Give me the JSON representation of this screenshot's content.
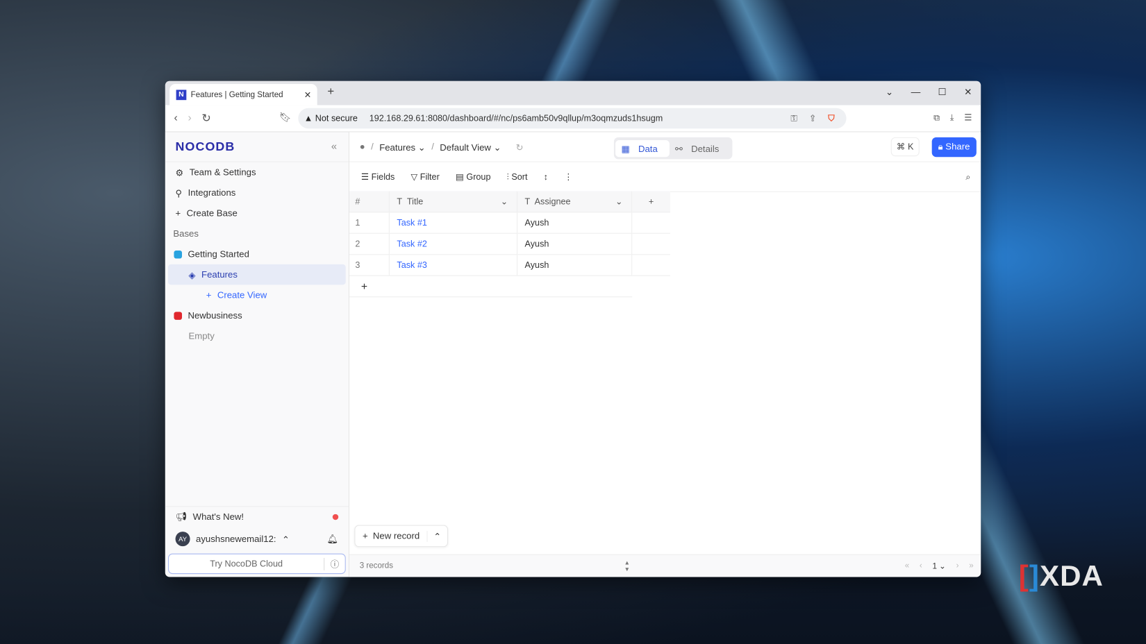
{
  "browser": {
    "tab_title": "Features | Getting Started",
    "security": "Not secure",
    "url": "192.168.29.61:8080/dashboard/#/nc/ps6amb50v9qllup/m3oqmzuds1hsugm"
  },
  "sidebar": {
    "logo": "NOCODB",
    "items": [
      {
        "label": "Team & Settings"
      },
      {
        "label": "Integrations"
      },
      {
        "label": "Create Base"
      }
    ],
    "bases_label": "Bases",
    "bases": [
      {
        "label": "Getting Started",
        "color": "#29a3e0",
        "tables": [
          {
            "label": "Features"
          }
        ],
        "create_view": "Create View"
      },
      {
        "label": "Newbusiness",
        "color": "#e0282e",
        "empty": "Empty"
      }
    ],
    "whats_new": "What's New!",
    "user_initials": "AY",
    "user_email": "ayushsnewemail12:",
    "try_cloud": "Try NocoDB Cloud"
  },
  "topbar": {
    "table": "Features",
    "view": "Default View",
    "tabs": [
      {
        "label": "Data",
        "active": true
      },
      {
        "label": "Details"
      }
    ],
    "shortcut": "⌘ K",
    "share": "Share"
  },
  "toolbar": {
    "fields": "Fields",
    "filter": "Filter",
    "group": "Group",
    "sort": "Sort"
  },
  "grid": {
    "columns": [
      "#",
      "Title",
      "Assignee"
    ],
    "rows": [
      {
        "n": "1",
        "title": "Task #1",
        "assignee": "Ayush"
      },
      {
        "n": "2",
        "title": "Task #2",
        "assignee": "Ayush"
      },
      {
        "n": "3",
        "title": "Task #3",
        "assignee": "Ayush"
      }
    ]
  },
  "footer": {
    "new_record": "New record",
    "records": "3 records",
    "page": "1"
  },
  "watermark": "XDA",
  "colors": {
    "accent": "#3366ff",
    "logo": "#2b2ea8"
  }
}
